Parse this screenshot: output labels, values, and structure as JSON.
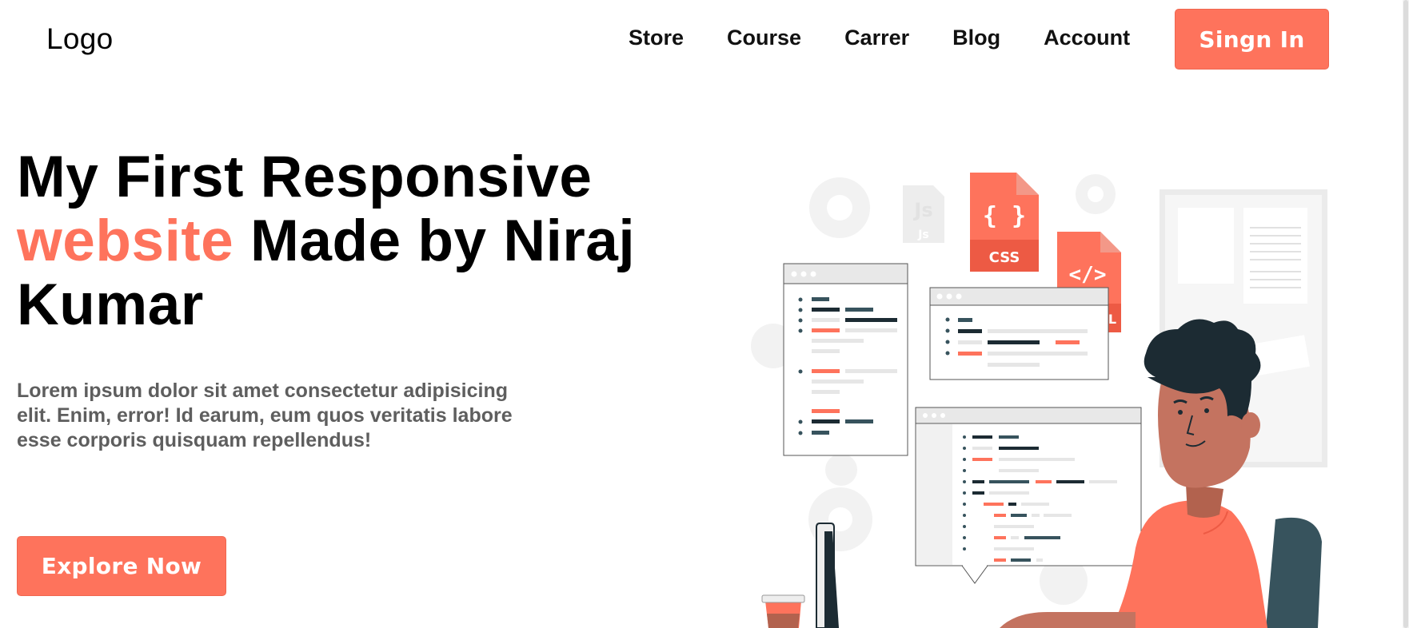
{
  "header": {
    "logo": "Logo",
    "nav": [
      "Store",
      "Course",
      "Carrer",
      "Blog",
      "Account"
    ],
    "signin_label": "Singn In"
  },
  "hero": {
    "title_part1": "My First Responsive",
    "title_accent": "website",
    "title_part2": " Made by Niraj Kumar",
    "description": "Lorem ipsum dolor sit amet consectetur adipisicing elit. Enim, error! Id earum, eum quos veritatis labore esse corporis quisquam repellendus!",
    "cta_label": "Explore Now"
  },
  "illustration": {
    "css_badge": "CSS",
    "css_braces": "{ }",
    "html_tag": "</>",
    "html_badge": "ML",
    "js_badge": "Js",
    "js_faint": "Js"
  },
  "colors": {
    "accent": "#fe735c",
    "dark": "#1c2b33",
    "slate": "#37535d",
    "gray_text": "#5e5e5e"
  }
}
